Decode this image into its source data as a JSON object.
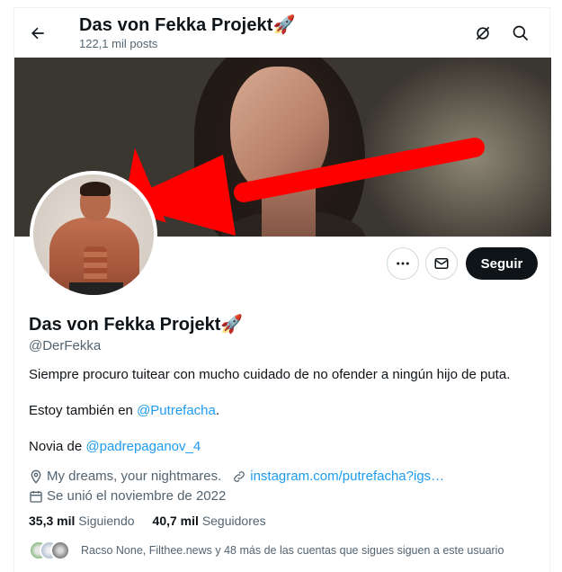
{
  "header": {
    "title": "Das von Fekka Projekt🚀",
    "post_count": "122,1 mil posts"
  },
  "icons": {
    "back": "arrow-left-icon",
    "hide": "eye-slash-icon",
    "search": "search-icon",
    "more": "more-horizontal-icon",
    "message": "envelope-icon",
    "location": "location-pin-icon",
    "link": "link-icon",
    "calendar": "calendar-icon"
  },
  "actions": {
    "follow_label": "Seguir"
  },
  "profile": {
    "name": "Das von Fekka Projekt🚀",
    "handle": "@DerFekka",
    "bio_line1": "Siempre procuro tuitear con mucho cuidado de no ofender a ningún hijo de puta.",
    "bio_line2_prefix": "Estoy también en ",
    "bio_line2_link": "@Putrefacha",
    "bio_line2_suffix": ".",
    "bio_line3_prefix": "Novia de ",
    "bio_line3_link": "@padrepaganov_4",
    "location": "My dreams, your nightmares.",
    "website": "instagram.com/putrefacha?igs…",
    "joined": "Se unió el noviembre de 2022"
  },
  "stats": {
    "following_count": "35,3 mil",
    "following_label": "Siguiendo",
    "followers_count": "40,7 mil",
    "followers_label": "Seguidores"
  },
  "followers_you_know": "Racso None, Filthee.news y 48 más de las cuentas que sigues siguen a este usuario",
  "colors": {
    "accent": "#1d9bf0",
    "text": "#0f1419",
    "muted": "#536471",
    "arrow": "#ff0000"
  }
}
